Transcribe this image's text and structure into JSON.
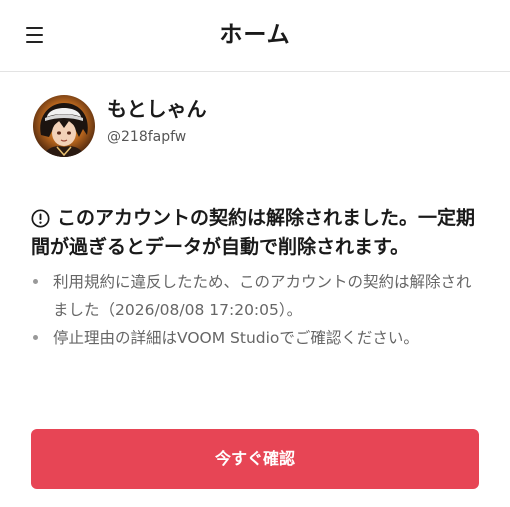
{
  "header": {
    "title": "ホーム",
    "menu_icon": "hamburger-menu-icon"
  },
  "profile": {
    "display_name": "もとしゃん",
    "user_id": "@218fapfw",
    "avatar": "user-avatar-image"
  },
  "notice": {
    "icon": "alert-circle-icon",
    "title": "このアカウントの契約は解除されました。一定期間が過ぎるとデータが自動で削除されます。",
    "bullets": [
      "利用規約に違反したため、このアカウントの契約は解除されました（2026/08/08 17:20:05）。",
      "停止理由の詳細はVOOM Studioでご確認ください。"
    ]
  },
  "cta": {
    "label": "今すぐ確認",
    "color": "#e74555"
  }
}
